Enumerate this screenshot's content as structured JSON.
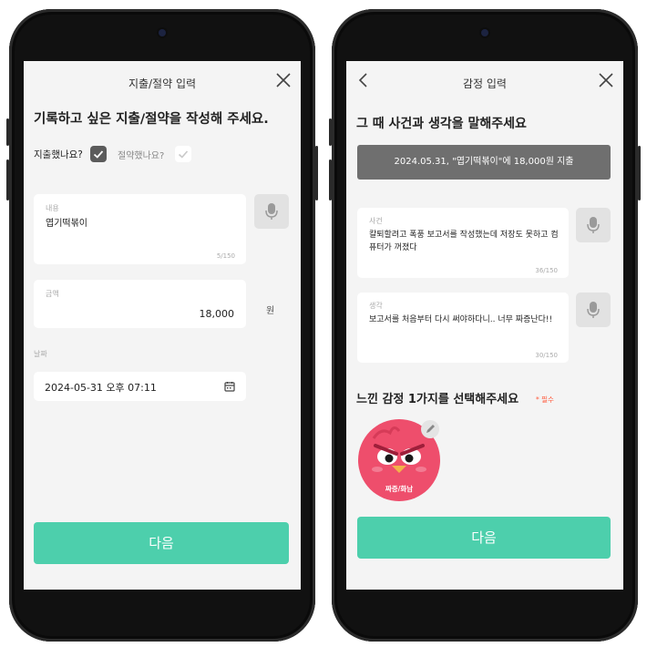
{
  "colors": {
    "accent": "#4dcfac",
    "banner": "#6f6f6f",
    "required": "#ff5a3c",
    "emotion": "#ee4e6c"
  },
  "left": {
    "header": {
      "title": "지출/절약 입력",
      "close_icon": "close-icon"
    },
    "heading": "기록하고 싶은 지출/절약을 작성해 주세요.",
    "type": {
      "spent_label": "지출했나요?",
      "spent_checked": true,
      "saved_label": "절약했나요?",
      "saved_checked": false
    },
    "content": {
      "label": "내용",
      "value": "엽기떡볶이",
      "counter": "5/150"
    },
    "amount": {
      "label": "금액",
      "value": "18,000",
      "unit": "원"
    },
    "date": {
      "label": "날짜",
      "value": "2024-05-31 오후 07:11"
    },
    "next_button": "다음"
  },
  "right": {
    "header": {
      "title": "감정 입력",
      "back_icon": "chevron-left-icon",
      "close_icon": "close-icon"
    },
    "heading": "그 때 사건과 생각을 말해주세요",
    "banner": "2024.05.31, \"엽기떡볶이\"에 18,000원 지출",
    "event": {
      "label": "사건",
      "value": "칼퇴할려고 폭풍 보고서를 작성했는데 저장도 못하고 컴퓨터가 꺼졌다",
      "counter": "36/150"
    },
    "thought": {
      "label": "생각",
      "value": "보고서를 처음부터 다시 써야하다니.. 너무 짜증난다!!",
      "counter": "30/150"
    },
    "emotion_heading": "느낀 감정 1가지를 선택해주세요",
    "required": "* 필수",
    "emotion": {
      "label": "짜증/화남",
      "edit_icon": "pencil-icon"
    },
    "next_button": "다음"
  }
}
